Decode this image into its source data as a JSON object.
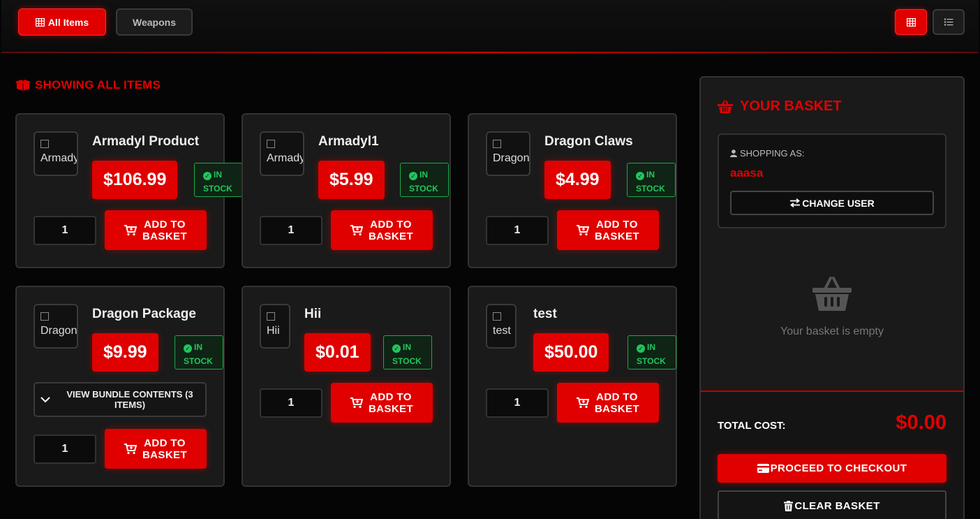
{
  "categories": [
    {
      "label": "All Items",
      "icon": "grid-icon",
      "active": true
    },
    {
      "label": "Weapons",
      "active": false
    }
  ],
  "view_modes": [
    {
      "icon": "grid-icon",
      "active": true
    },
    {
      "icon": "list-icon",
      "active": false
    }
  ],
  "section_title": "SHOWING ALL ITEMS",
  "products": [
    {
      "name": "Armadyl Product",
      "thumb_alt": "Armadyl",
      "price": "$106.99",
      "stock_line1": "IN",
      "stock_line2": "STOCK",
      "qty": "1",
      "add_line1": "ADD TO",
      "add_line2": "BASKET"
    },
    {
      "name": "Armadyl1",
      "thumb_alt": "Armadyl",
      "price": "$5.99",
      "stock_line1": "IN",
      "stock_line2": "STOCK",
      "qty": "1",
      "add_line1": "ADD TO",
      "add_line2": "BASKET"
    },
    {
      "name": "Dragon Claws",
      "thumb_alt": "Dragon",
      "price": "$4.99",
      "stock_line1": "IN",
      "stock_line2": "STOCK",
      "qty": "1",
      "add_line1": "ADD TO",
      "add_line2": "BASKET"
    },
    {
      "name": "Dragon Package",
      "thumb_alt": "Dragon",
      "price": "$9.99",
      "stock_line1": "IN",
      "stock_line2": "STOCK",
      "qty": "1",
      "add_line1": "ADD TO",
      "add_line2": "BASKET",
      "bundle_line1": "VIEW BUNDLE CONTENTS (3",
      "bundle_line2": "ITEMS)"
    },
    {
      "name": "Hii",
      "thumb_alt": "Hii",
      "price": "$0.01",
      "stock_line1": "IN",
      "stock_line2": "STOCK",
      "qty": "1",
      "add_line1": "ADD TO",
      "add_line2": "BASKET"
    },
    {
      "name": "test",
      "thumb_alt": "test",
      "price": "$50.00",
      "stock_line1": "IN",
      "stock_line2": "STOCK",
      "qty": "1",
      "add_line1": "ADD TO",
      "add_line2": "BASKET"
    }
  ],
  "basket": {
    "title": "YOUR BASKET",
    "shopping_as_label": "SHOPPING AS:",
    "username": "aaasa",
    "change_user_label": "CHANGE USER",
    "empty_text": "Your basket is empty",
    "total_label": "TOTAL COST:",
    "total_value": "$0.00",
    "checkout_label": "PROCEED TO CHECKOUT",
    "clear_label": "CLEAR BASKET"
  },
  "colors": {
    "accent": "#e00000",
    "in_stock": "#22c55e",
    "background": "#050505",
    "card": "#1a1a1a"
  }
}
